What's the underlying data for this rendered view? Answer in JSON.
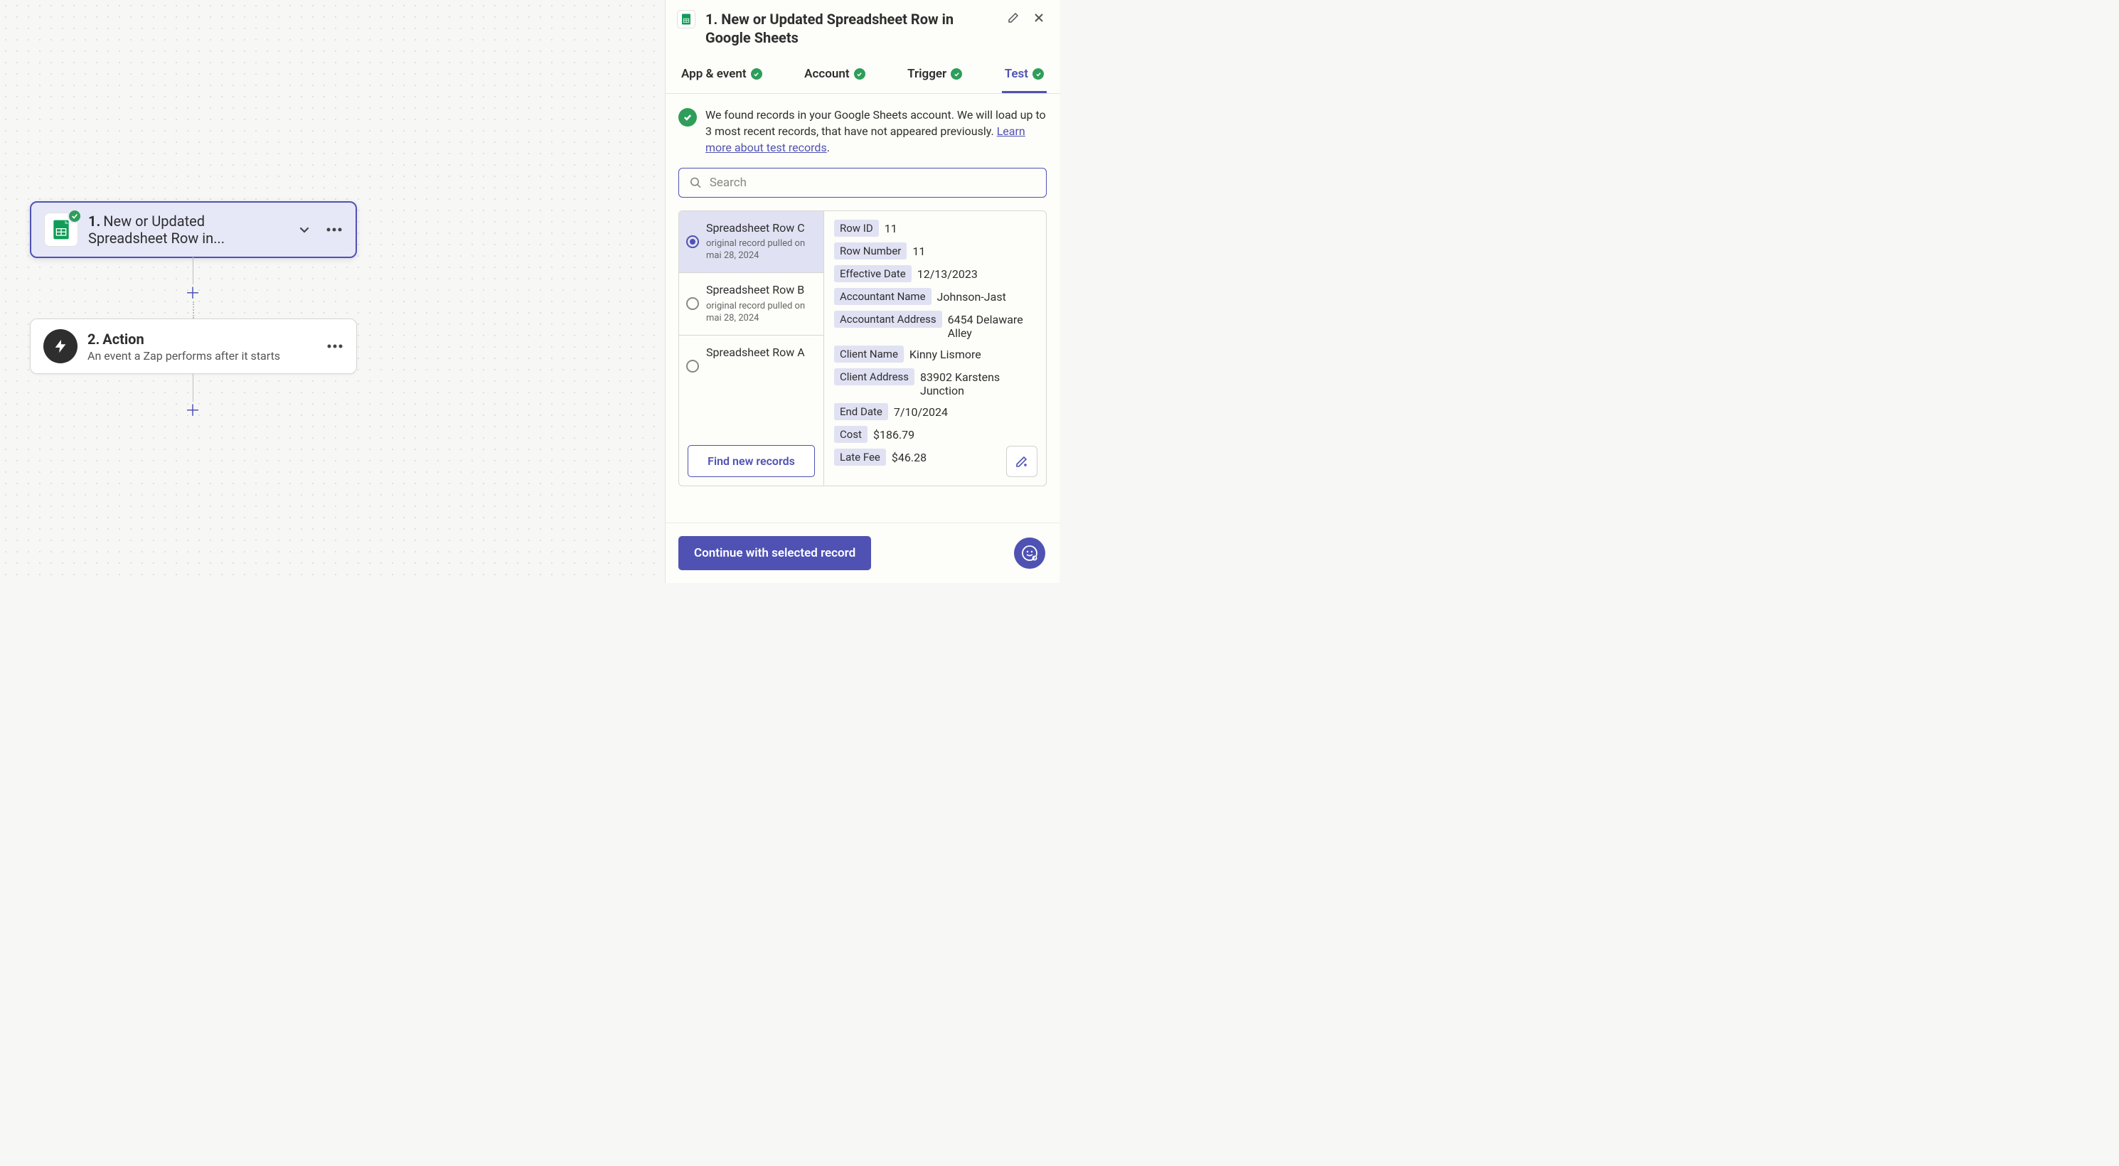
{
  "canvas": {
    "step1": {
      "num": "1.",
      "title": "New or Updated Spreadsheet Row in..."
    },
    "step2": {
      "num": "2.",
      "title": "Action",
      "subtitle": "An event a Zap performs after it starts"
    }
  },
  "panel": {
    "title": "1. New or Updated Spreadsheet Row in Google Sheets",
    "tabs": {
      "app": "App & event",
      "account": "Account",
      "trigger": "Trigger",
      "test": "Test"
    },
    "info_text_a": "We found records in your Google Sheets account. We will load up to 3 most recent records, that have not appeared previously. ",
    "info_link": "Learn more about test records",
    "info_suffix": ".",
    "search_placeholder": "Search",
    "records": [
      {
        "name": "Spreadsheet Row C",
        "sub": "original record pulled on mai 28, 2024"
      },
      {
        "name": "Spreadsheet Row B",
        "sub": "original record pulled on mai 28, 2024"
      },
      {
        "name": "Spreadsheet Row A",
        "sub": ""
      }
    ],
    "find_btn": "Find new records",
    "details": [
      {
        "key": "Row ID",
        "val": "11"
      },
      {
        "key": "Row Number",
        "val": "11"
      },
      {
        "key": "Effective Date",
        "val": "12/13/2023"
      },
      {
        "key": "Accountant Name",
        "val": "Johnson-Jast"
      },
      {
        "key": "Accountant Address",
        "val": "6454 Delaware Alley"
      },
      {
        "key": "Client Name",
        "val": "Kinny Lismore"
      },
      {
        "key": "Client Address",
        "val": "83902 Karstens Junction"
      },
      {
        "key": "End Date",
        "val": "7/10/2024"
      },
      {
        "key": "Cost",
        "val": "$186.79"
      },
      {
        "key": "Late Fee",
        "val": "$46.28"
      }
    ],
    "continue_btn": "Continue with selected record"
  }
}
